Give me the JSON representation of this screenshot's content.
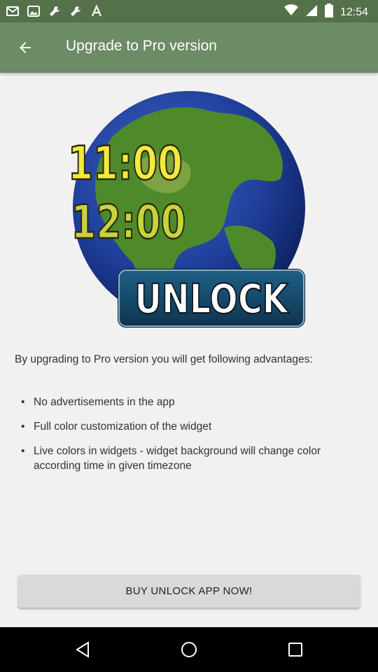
{
  "status_bar": {
    "time": "12:54",
    "left_icons": [
      "gmail-icon",
      "image-icon",
      "wrench-icon",
      "wrench-icon",
      "text-a-icon"
    ],
    "right_icons": [
      "wifi-icon",
      "signal-icon",
      "battery-icon"
    ]
  },
  "app_bar": {
    "title": "Upgrade to Pro version",
    "back_icon": "back-arrow-icon"
  },
  "hero": {
    "time1": "11:00",
    "time2": "12:00",
    "button": "UNLOCK"
  },
  "content": {
    "intro": "By upgrading to Pro version you will get following advantages:",
    "bullets": [
      "No advertisements in the app",
      "Full color customization of the widget",
      "Live colors in widgets - widget background will change color according time in given timezone"
    ]
  },
  "buy_button": {
    "label": "BUY UNLOCK APP NOW!"
  },
  "nav": {
    "items": [
      "back-triangle-icon",
      "home-circle-icon",
      "recents-square-icon"
    ]
  },
  "colors": {
    "status_bar": "#55714a",
    "app_bar": "#6d8b64",
    "background": "#f1f1f1"
  }
}
